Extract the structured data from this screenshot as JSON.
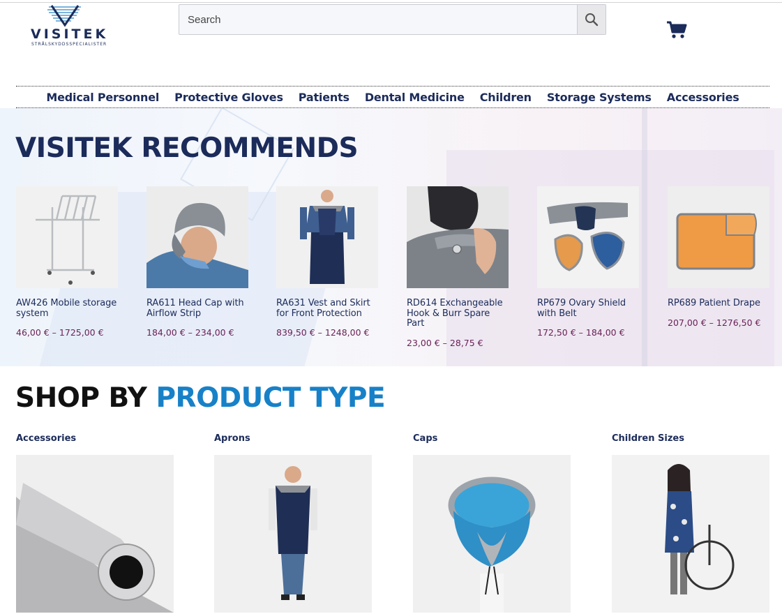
{
  "header": {
    "logo_word": "VISITEK",
    "logo_tagline": "STRÅLSKYDDSSPECIALISTER",
    "search_placeholder": "Search"
  },
  "nav": {
    "items": [
      "Medical Personnel",
      "Protective Gloves",
      "Patients",
      "Dental Medicine",
      "Children",
      "Storage Systems",
      "Accessories"
    ]
  },
  "recommends": {
    "title": "VISITEK RECOMMENDS",
    "products": [
      {
        "name": "AW426 Mobile storage system",
        "price": "46,00 € – 1725,00 €"
      },
      {
        "name": "RA611 Head Cap with Airflow Strip",
        "price": "184,00 € – 234,00 €"
      },
      {
        "name": "RA631 Vest and Skirt for Front Protection",
        "price": "839,50 € – 1248,00 €"
      },
      {
        "name": "RD614 Exchangeable Hook & Burr Spare Part",
        "price": "23,00 € – 28,75 €"
      },
      {
        "name": "RP679 Ovary Shield with Belt",
        "price": "172,50 € – 184,00 €"
      },
      {
        "name": "RP689 Patient Drape",
        "price": "207,00 € – 1276,50 €"
      }
    ]
  },
  "shop_by": {
    "title_part1": "SHOP BY",
    "title_part2": "PRODUCT TYPE",
    "categories": [
      "Accessories",
      "Aprons",
      "Caps",
      "Children Sizes"
    ]
  },
  "colors": {
    "navy": "#1b2b5a",
    "accent_blue": "#1781c8",
    "price": "#6b2157"
  }
}
